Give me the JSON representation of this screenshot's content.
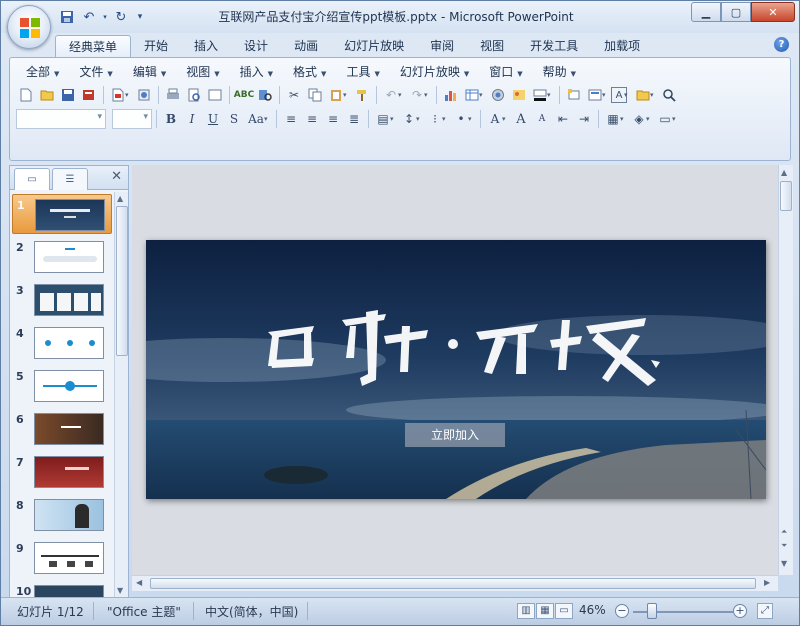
{
  "window": {
    "title": "互联网产品支付宝介绍宣传ppt模板.pptx - Microsoft PowerPoint"
  },
  "ribbon_tabs": [
    "经典菜单",
    "开始",
    "插入",
    "设计",
    "动画",
    "幻灯片放映",
    "审阅",
    "视图",
    "开发工具",
    "加载项"
  ],
  "menu": [
    "全部",
    "文件",
    "编辑",
    "视图",
    "插入",
    "格式",
    "工具",
    "幻灯片放映",
    "窗口",
    "帮助"
  ],
  "format_buttons": [
    "B",
    "I",
    "U",
    "S",
    "Aa"
  ],
  "thumbnails": [
    {
      "number": "1",
      "selected": true
    },
    {
      "number": "2"
    },
    {
      "number": "3"
    },
    {
      "number": "4"
    },
    {
      "number": "5"
    },
    {
      "number": "6"
    },
    {
      "number": "7"
    },
    {
      "number": "8"
    },
    {
      "number": "9"
    },
    {
      "number": "10"
    }
  ],
  "slide": {
    "join_button": "立即加入"
  },
  "status": {
    "slide_info": "幻灯片 1/12",
    "theme": "\"Office 主题\"",
    "language": "中文(简体，中国)",
    "zoom": "46%"
  },
  "colors": {
    "accent": "#e99a3d",
    "ribbon_border": "#9cb3d1",
    "slide_sky": "#163052"
  }
}
